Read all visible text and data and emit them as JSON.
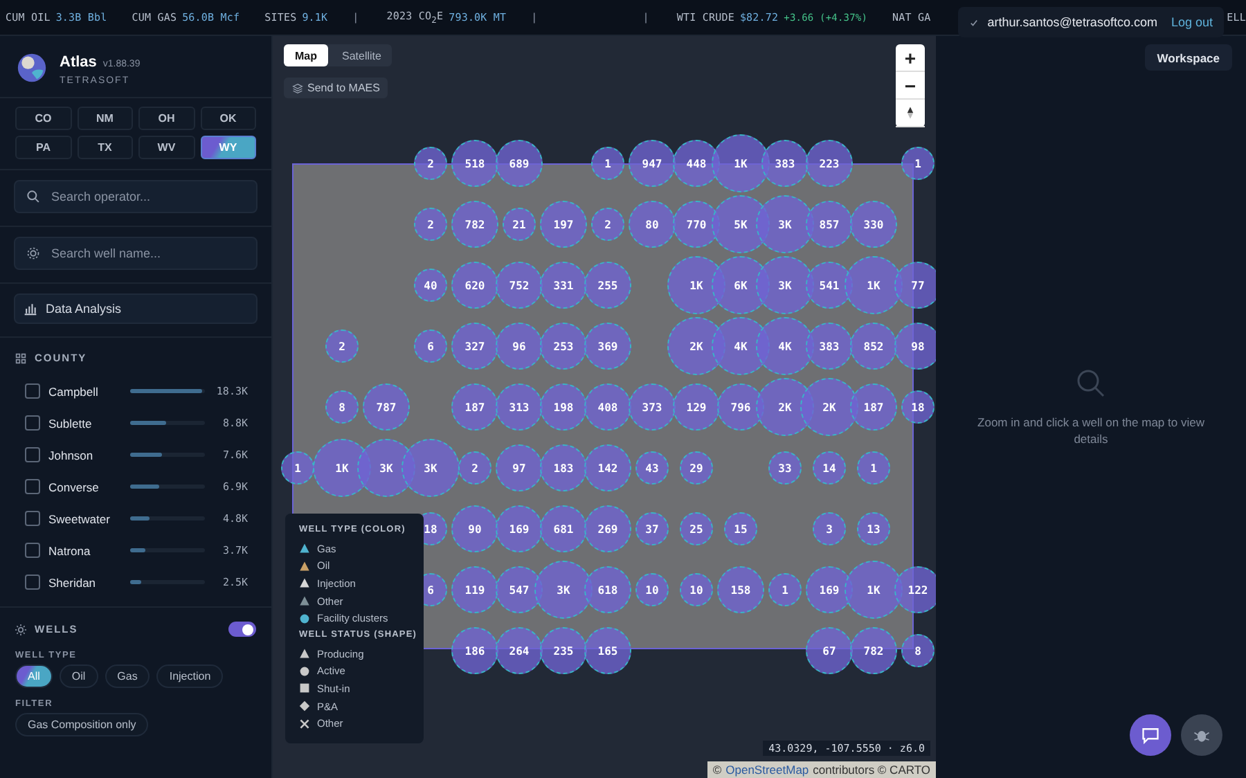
{
  "ticker": [
    {
      "kind": "metric",
      "label": "CUM OIL",
      "value": "3.3B Bbl"
    },
    {
      "kind": "metric",
      "label": "CUM GAS",
      "value": "56.0B Mcf"
    },
    {
      "kind": "metric",
      "label": "SITES",
      "value": "9.1K"
    },
    {
      "kind": "sep",
      "label": "|"
    },
    {
      "kind": "metric",
      "label": "2023 CO$_{2}$E",
      "value": "793.0K MT"
    },
    {
      "kind": "sep",
      "label": "|"
    },
    {
      "kind": "gap"
    },
    {
      "kind": "sep",
      "label": "|"
    },
    {
      "kind": "quote",
      "label": "WTI CRUDE",
      "value": "$82.72",
      "change": "+3.66 (+4.37%)"
    },
    {
      "kind": "metric",
      "label": "NAT GA"
    }
  ],
  "ticker_tail": "ELL",
  "user": {
    "email": "arthur.santos@tetrasoftco.com",
    "logout": "Log out",
    "workspace": "Workspace"
  },
  "app": {
    "name": "Atlas",
    "version": "v1.88.39",
    "company": "TETRASOFT"
  },
  "states": [
    {
      "label": "CO",
      "selected": false
    },
    {
      "label": "NM",
      "selected": false
    },
    {
      "label": "OH",
      "selected": false
    },
    {
      "label": "OK",
      "selected": false
    },
    {
      "label": "PA",
      "selected": false
    },
    {
      "label": "TX",
      "selected": false
    },
    {
      "label": "WV",
      "selected": false
    },
    {
      "label": "WY",
      "selected": true
    }
  ],
  "search_operator": {
    "placeholder": "Search operator..."
  },
  "search_well": {
    "placeholder": "Search well name..."
  },
  "data_analysis": "Data Analysis",
  "county": {
    "title": "COUNTY",
    "items": [
      {
        "name": "Campbell",
        "checked": false,
        "level": 0.97,
        "value": "18.3K"
      },
      {
        "name": "Sublette",
        "checked": false,
        "level": 0.48,
        "value": "8.8K"
      },
      {
        "name": "Johnson",
        "checked": false,
        "level": 0.42,
        "value": "7.6K"
      },
      {
        "name": "Converse",
        "checked": false,
        "level": 0.38,
        "value": "6.9K"
      },
      {
        "name": "Sweetwater",
        "checked": false,
        "level": 0.26,
        "value": "4.8K"
      },
      {
        "name": "Natrona",
        "checked": false,
        "level": 0.2,
        "value": "3.7K"
      },
      {
        "name": "Sheridan",
        "checked": false,
        "level": 0.14,
        "value": "2.5K"
      }
    ]
  },
  "wells": {
    "title": "WELLS",
    "on": true,
    "type_label": "WELL TYPE",
    "types": [
      {
        "label": "All",
        "selected": true
      },
      {
        "label": "Oil",
        "selected": false
      },
      {
        "label": "Gas",
        "selected": false
      },
      {
        "label": "Injection",
        "selected": false
      }
    ],
    "filter_label": "FILTER",
    "filters": [
      {
        "label": "Gas Composition only",
        "selected": false
      }
    ]
  },
  "map": {
    "tabs": [
      {
        "label": "Map",
        "selected": true
      },
      {
        "label": "Satellite",
        "selected": false
      }
    ],
    "send": "Send to MAES",
    "zoom_in": "+",
    "zoom_out": "−",
    "clusters": [
      [
        {
          "kind": "gap"
        },
        {
          "kind": "gap"
        },
        {
          "kind": "gap"
        },
        {
          "kind": "small",
          "count": "2"
        },
        {
          "kind": "medium",
          "count": "518"
        },
        {
          "kind": "medium",
          "count": "689"
        },
        {
          "kind": "gap"
        },
        {
          "kind": "small",
          "count": "1"
        },
        {
          "kind": "medium",
          "count": "947"
        },
        {
          "kind": "medium",
          "count": "448"
        },
        {
          "kind": "large",
          "count": "1K"
        },
        {
          "kind": "medium",
          "count": "383"
        },
        {
          "kind": "medium",
          "count": "223"
        },
        {
          "kind": "gap"
        },
        {
          "kind": "small",
          "count": "1"
        }
      ],
      [
        {
          "kind": "gap"
        },
        {
          "kind": "gap"
        },
        {
          "kind": "gap"
        },
        {
          "kind": "small",
          "count": "2"
        },
        {
          "kind": "medium",
          "count": "782"
        },
        {
          "kind": "small",
          "count": "21"
        },
        {
          "kind": "medium",
          "count": "197"
        },
        {
          "kind": "small",
          "count": "2"
        },
        {
          "kind": "medium",
          "count": "80"
        },
        {
          "kind": "medium",
          "count": "770"
        },
        {
          "kind": "large",
          "count": "5K"
        },
        {
          "kind": "large",
          "count": "3K"
        },
        {
          "kind": "medium",
          "count": "857"
        },
        {
          "kind": "medium",
          "count": "330"
        }
      ],
      [
        {
          "kind": "gap"
        },
        {
          "kind": "gap"
        },
        {
          "kind": "gap"
        },
        {
          "kind": "small",
          "count": "40"
        },
        {
          "kind": "medium",
          "count": "620"
        },
        {
          "kind": "medium",
          "count": "752"
        },
        {
          "kind": "medium",
          "count": "331"
        },
        {
          "kind": "medium",
          "count": "255"
        },
        {
          "kind": "gap"
        },
        {
          "kind": "large",
          "count": "1K"
        },
        {
          "kind": "large",
          "count": "6K"
        },
        {
          "kind": "large",
          "count": "3K"
        },
        {
          "kind": "medium",
          "count": "541"
        },
        {
          "kind": "large",
          "count": "1K"
        },
        {
          "kind": "medium",
          "count": "77"
        }
      ],
      [
        {
          "kind": "gap"
        },
        {
          "kind": "small",
          "count": "2"
        },
        {
          "kind": "gap"
        },
        {
          "kind": "small",
          "count": "6"
        },
        {
          "kind": "medium",
          "count": "327"
        },
        {
          "kind": "medium",
          "count": "96"
        },
        {
          "kind": "medium",
          "count": "253"
        },
        {
          "kind": "medium",
          "count": "369"
        },
        {
          "kind": "gap"
        },
        {
          "kind": "large",
          "count": "2K"
        },
        {
          "kind": "large",
          "count": "4K"
        },
        {
          "kind": "large",
          "count": "4K"
        },
        {
          "kind": "medium",
          "count": "383"
        },
        {
          "kind": "medium",
          "count": "852"
        },
        {
          "kind": "medium",
          "count": "98"
        }
      ],
      [
        {
          "kind": "gap"
        },
        {
          "kind": "small",
          "count": "8"
        },
        {
          "kind": "medium",
          "count": "787"
        },
        {
          "kind": "gap"
        },
        {
          "kind": "medium",
          "count": "187"
        },
        {
          "kind": "medium",
          "count": "313"
        },
        {
          "kind": "medium",
          "count": "198"
        },
        {
          "kind": "medium",
          "count": "408"
        },
        {
          "kind": "medium",
          "count": "373"
        },
        {
          "kind": "medium",
          "count": "129"
        },
        {
          "kind": "medium",
          "count": "796"
        },
        {
          "kind": "large",
          "count": "2K"
        },
        {
          "kind": "large",
          "count": "2K"
        },
        {
          "kind": "medium",
          "count": "187"
        },
        {
          "kind": "small",
          "count": "18"
        }
      ],
      [
        {
          "kind": "small",
          "count": "1"
        },
        {
          "kind": "large",
          "count": "1K"
        },
        {
          "kind": "large",
          "count": "3K"
        },
        {
          "kind": "large",
          "count": "3K"
        },
        {
          "kind": "small",
          "count": "2"
        },
        {
          "kind": "medium",
          "count": "97"
        },
        {
          "kind": "medium",
          "count": "183"
        },
        {
          "kind": "medium",
          "count": "142"
        },
        {
          "kind": "small",
          "count": "43"
        },
        {
          "kind": "small",
          "count": "29"
        },
        {
          "kind": "gap"
        },
        {
          "kind": "small",
          "count": "33"
        },
        {
          "kind": "small",
          "count": "14"
        },
        {
          "kind": "small",
          "count": "1"
        }
      ],
      [
        {
          "kind": "gap"
        },
        {
          "kind": "gap"
        },
        {
          "kind": "gap"
        },
        {
          "kind": "small",
          "count": "18"
        },
        {
          "kind": "medium",
          "count": "90"
        },
        {
          "kind": "medium",
          "count": "169"
        },
        {
          "kind": "medium",
          "count": "681"
        },
        {
          "kind": "medium",
          "count": "269"
        },
        {
          "kind": "small",
          "count": "37"
        },
        {
          "kind": "small",
          "count": "25"
        },
        {
          "kind": "small",
          "count": "15"
        },
        {
          "kind": "gap"
        },
        {
          "kind": "small",
          "count": "3"
        },
        {
          "kind": "small",
          "count": "13"
        }
      ],
      [
        {
          "kind": "gap"
        },
        {
          "kind": "gap"
        },
        {
          "kind": "gap"
        },
        {
          "kind": "small",
          "count": "6"
        },
        {
          "kind": "medium",
          "count": "119"
        },
        {
          "kind": "medium",
          "count": "547"
        },
        {
          "kind": "large",
          "count": "3K"
        },
        {
          "kind": "medium",
          "count": "618"
        },
        {
          "kind": "small",
          "count": "10"
        },
        {
          "kind": "small",
          "count": "10"
        },
        {
          "kind": "medium",
          "count": "158"
        },
        {
          "kind": "small",
          "count": "1"
        },
        {
          "kind": "medium",
          "count": "169"
        },
        {
          "kind": "large",
          "count": "1K"
        },
        {
          "kind": "medium",
          "count": "122"
        }
      ],
      [
        {
          "kind": "gap"
        },
        {
          "kind": "gap"
        },
        {
          "kind": "gap"
        },
        {
          "kind": "gap"
        },
        {
          "kind": "medium",
          "count": "186"
        },
        {
          "kind": "medium",
          "count": "264"
        },
        {
          "kind": "medium",
          "count": "235"
        },
        {
          "kind": "medium",
          "count": "165"
        },
        {
          "kind": "gap"
        },
        {
          "kind": "gap"
        },
        {
          "kind": "gap"
        },
        {
          "kind": "gap"
        },
        {
          "kind": "medium",
          "count": "67"
        },
        {
          "kind": "medium",
          "count": "782"
        },
        {
          "kind": "small",
          "count": "8"
        }
      ]
    ],
    "legend": [
      {
        "title": "WELL TYPE (COLOR)",
        "items": [
          {
            "label": "Gas",
            "kind": "triangle",
            "color": "#4fb3cf"
          },
          {
            "label": "Oil",
            "kind": "triangle",
            "color": "#c9a066"
          },
          {
            "label": "Injection",
            "kind": "triangle",
            "color": "#d6d6d6"
          },
          {
            "label": "Other",
            "kind": "triangle",
            "color": "#7d8f96"
          },
          {
            "label": "Facility clusters",
            "kind": "circle",
            "color": "#4fb3cf"
          }
        ]
      },
      {
        "title": "WELL STATUS (SHAPE)",
        "items": [
          {
            "label": "Producing",
            "kind": "triangle",
            "color": "#c8c8c8"
          },
          {
            "label": "Active",
            "kind": "circle",
            "color": "#c8c8c8"
          },
          {
            "label": "Shut-in",
            "kind": "square",
            "color": "#c8c8c8"
          },
          {
            "label": "P&A",
            "kind": "diamond",
            "color": "#c8c8c8"
          },
          {
            "label": "Other",
            "kind": "cross",
            "color": "#c8c8c8"
          }
        ]
      }
    ],
    "coordinates": "43.0329, -107.5550 · z6.0",
    "attribution": {
      "osm": "OpenStreetMap",
      "rest": "contributors © CARTO",
      "copy": "©"
    }
  },
  "details": {
    "hint": "Zoom in and click a well on the map to view details"
  }
}
